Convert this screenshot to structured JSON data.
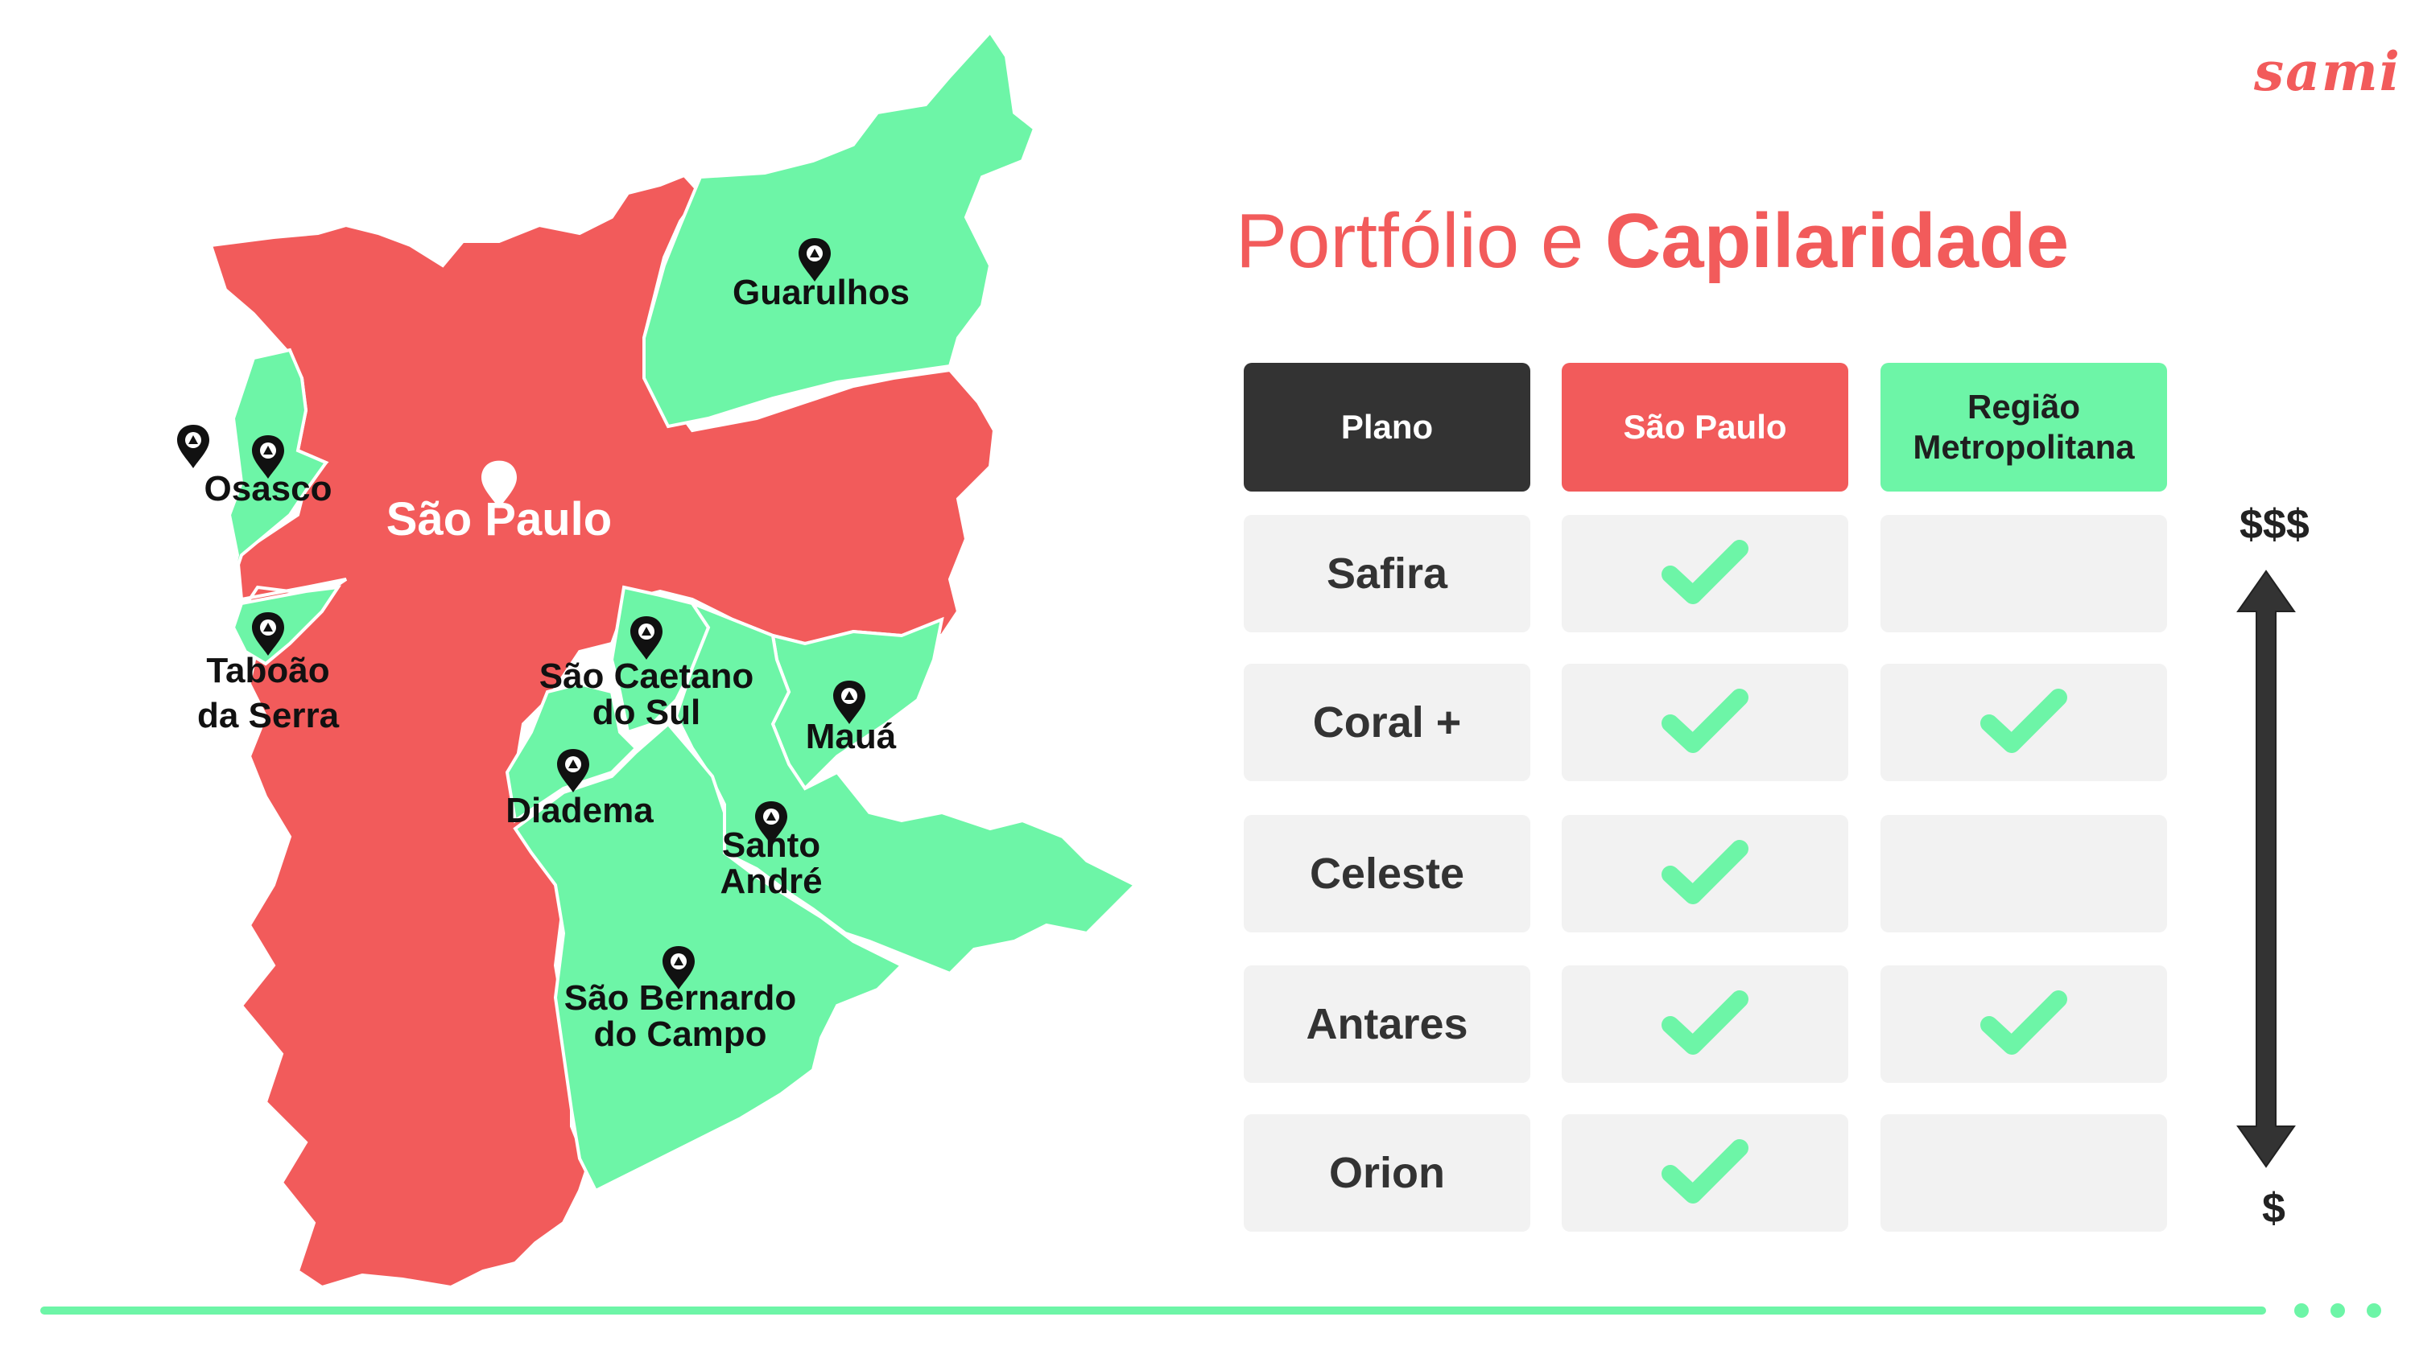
{
  "brand": {
    "logo": "sami",
    "accent": "#f25b5b",
    "green": "#6df5a7",
    "dark": "#333333"
  },
  "title": {
    "part1": "Portfólio e ",
    "part2": "Capilaridade"
  },
  "map": {
    "cities": [
      {
        "id": "sao-paulo",
        "label": "São Paulo",
        "color": "red"
      },
      {
        "id": "guarulhos",
        "label": "Guarulhos",
        "color": "green"
      },
      {
        "id": "osasco",
        "label": "Osasco",
        "color": "green"
      },
      {
        "id": "taboao",
        "label1": "Taboão",
        "label2": "da Serra",
        "color": "green"
      },
      {
        "id": "sao-caetano",
        "label1": "São Caetano",
        "label2": "do Sul",
        "color": "green"
      },
      {
        "id": "maua",
        "label": "Mauá",
        "color": "green"
      },
      {
        "id": "diadema",
        "label": "Diadema",
        "color": "green"
      },
      {
        "id": "santo-andre",
        "label1": "Santo",
        "label2": "André",
        "color": "green"
      },
      {
        "id": "sao-bernardo",
        "label1": "São Bernardo",
        "label2": "do Campo",
        "color": "green"
      }
    ]
  },
  "table": {
    "headers": {
      "plano": "Plano",
      "sao_paulo": "São Paulo",
      "regiao_line1": "Região",
      "regiao_line2": "Metropolitana"
    },
    "rows": [
      {
        "name": "Safira",
        "sao_paulo": true,
        "regiao": false
      },
      {
        "name": "Coral +",
        "sao_paulo": true,
        "regiao": true
      },
      {
        "name": "Celeste",
        "sao_paulo": true,
        "regiao": false
      },
      {
        "name": "Antares",
        "sao_paulo": true,
        "regiao": true
      },
      {
        "name": "Orion",
        "sao_paulo": true,
        "regiao": false
      }
    ]
  },
  "price_scale": {
    "top": "$$$",
    "bottom": "$"
  }
}
